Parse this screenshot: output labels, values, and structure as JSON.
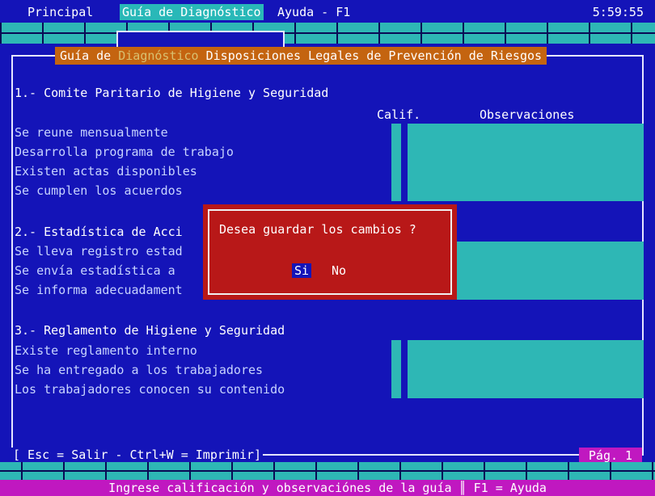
{
  "menu": {
    "principal": "Principal",
    "guia": "Guía de Diagnóstico",
    "ayuda": "Ayuda - F1",
    "clock": "5:59:55"
  },
  "frame": {
    "title_part1": "Guía de",
    "title_part2": "Diagnóstico",
    "title_part3": "Disposiciones Legales de Prevención de Riesgos"
  },
  "columns": {
    "calif": "Calif.",
    "observaciones": "Observaciones"
  },
  "sections": [
    {
      "title": "1.- Comite Paritario de Higiene y Seguridad",
      "items": [
        "Se reune mensualmente",
        "Desarrolla programa de trabajo",
        "Existen actas disponibles",
        "Se cumplen los acuerdos"
      ]
    },
    {
      "title": "2.- Estadística de Acci",
      "items": [
        "Se lleva registro estad",
        "Se envía estadística a",
        "Se informa adecuadament"
      ]
    },
    {
      "title": "3.- Reglamento de Higiene y Seguridad",
      "items": [
        "Existe reglamento interno",
        "Se ha entregado a los trabajadores",
        "Los trabajadores conocen su contenido"
      ]
    }
  ],
  "footer": {
    "esc": "[ Esc = Salir - Ctrl+W = Imprimir]",
    "page": "Pág. 1",
    "status": "Ingrese calificación y observaciónes de la guía ║ F1 = Ayuda"
  },
  "dialog": {
    "question": "Desea guardar los cambios ?",
    "yes": "Si",
    "no": "No"
  },
  "colors": {
    "background": "#1414b8",
    "cyan": "#2eb7b5",
    "title_bar": "#c46410",
    "status_bar": "#c018c0",
    "dialog": "#b81818"
  }
}
